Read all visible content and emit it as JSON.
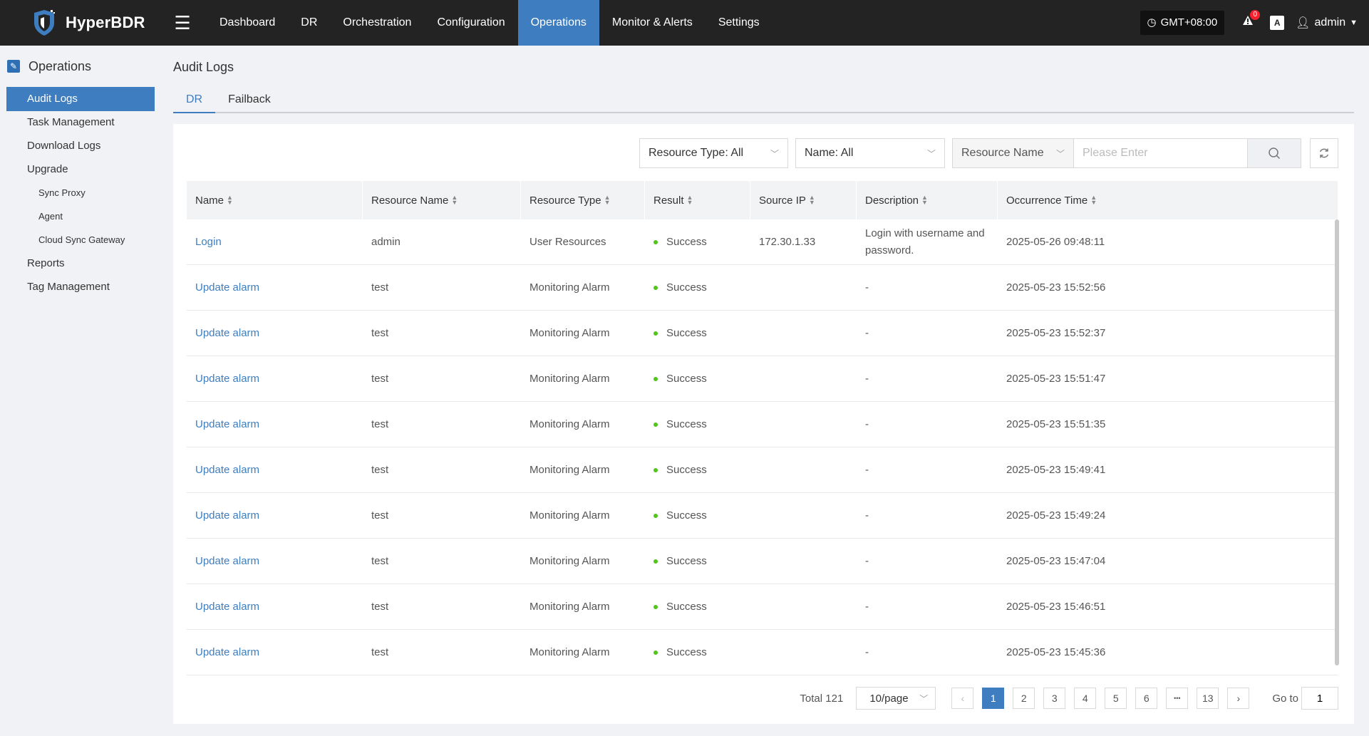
{
  "app": {
    "name": "HyperBDR",
    "timezone": "GMT+08:00",
    "alert_count": "0",
    "lang_label": "A",
    "user": "admin"
  },
  "nav": [
    "Dashboard",
    "DR",
    "Orchestration",
    "Configuration",
    "Operations",
    "Monitor & Alerts",
    "Settings"
  ],
  "sidebar": {
    "section": "Operations",
    "items": [
      {
        "label": "Audit Logs",
        "level": 1,
        "active": true
      },
      {
        "label": "Task Management",
        "level": 1
      },
      {
        "label": "Download Logs",
        "level": 1
      },
      {
        "label": "Upgrade",
        "level": 1
      },
      {
        "label": "Sync Proxy",
        "level": 2
      },
      {
        "label": "Agent",
        "level": 2
      },
      {
        "label": "Cloud Sync Gateway",
        "level": 2
      },
      {
        "label": "Reports",
        "level": 1
      },
      {
        "label": "Tag Management",
        "level": 1
      }
    ]
  },
  "page": {
    "title": "Audit Logs",
    "tabs": [
      "DR",
      "Failback"
    ]
  },
  "filters": {
    "resource_type": "Resource Type: All",
    "name": "Name: All",
    "search_field": "Resource Name",
    "search_placeholder": "Please Enter"
  },
  "table": {
    "columns": [
      "Name",
      "Resource Name",
      "Resource Type",
      "Result",
      "Source IP",
      "Description",
      "Occurrence Time"
    ],
    "rows": [
      [
        "Login",
        "admin",
        "User Resources",
        "Success",
        "172.30.1.33",
        "Login with username and password.",
        "2025-05-26 09:48:11"
      ],
      [
        "Update alarm",
        "test",
        "Monitoring Alarm",
        "Success",
        "",
        "-",
        "2025-05-23 15:52:56"
      ],
      [
        "Update alarm",
        "test",
        "Monitoring Alarm",
        "Success",
        "",
        "-",
        "2025-05-23 15:52:37"
      ],
      [
        "Update alarm",
        "test",
        "Monitoring Alarm",
        "Success",
        "",
        "-",
        "2025-05-23 15:51:47"
      ],
      [
        "Update alarm",
        "test",
        "Monitoring Alarm",
        "Success",
        "",
        "-",
        "2025-05-23 15:51:35"
      ],
      [
        "Update alarm",
        "test",
        "Monitoring Alarm",
        "Success",
        "",
        "-",
        "2025-05-23 15:49:41"
      ],
      [
        "Update alarm",
        "test",
        "Monitoring Alarm",
        "Success",
        "",
        "-",
        "2025-05-23 15:49:24"
      ],
      [
        "Update alarm",
        "test",
        "Monitoring Alarm",
        "Success",
        "",
        "-",
        "2025-05-23 15:47:04"
      ],
      [
        "Update alarm",
        "test",
        "Monitoring Alarm",
        "Success",
        "",
        "-",
        "2025-05-23 15:46:51"
      ],
      [
        "Update alarm",
        "test",
        "Monitoring Alarm",
        "Success",
        "",
        "-",
        "2025-05-23 15:45:36"
      ]
    ]
  },
  "pagination": {
    "total": "Total 121",
    "page_size": "10/page",
    "pages": [
      "1",
      "2",
      "3",
      "4",
      "5",
      "6",
      "•••",
      "13"
    ],
    "current": "1",
    "goto_label": "Go to",
    "goto_value": "1"
  },
  "colors": {
    "accent": "#3e7ec0",
    "topbar": "#232323",
    "success": "#52c41a",
    "alert": "#f5222d"
  }
}
